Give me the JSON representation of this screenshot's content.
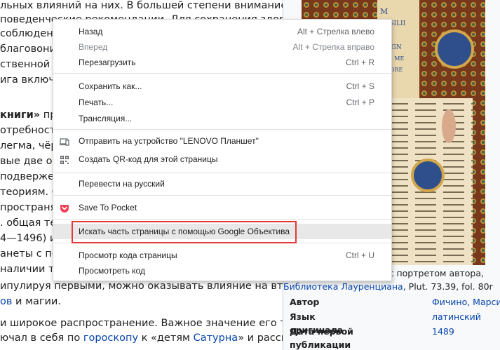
{
  "article": {
    "lines": [
      {
        "segs": [
          {
            "t": "льных влияний на них. В большей степени внимание"
          }
        ]
      },
      {
        "segs": [
          {
            "t": " поведенческие рекомендации. Для сохранения здоровья"
          }
        ]
      },
      {
        "segs": [
          {
            "t": "соблюдени"
          }
        ]
      },
      {
        "segs": [
          {
            "t": "благовония"
          }
        ]
      },
      {
        "segs": [
          {
            "t": "ственной бл"
          }
        ]
      },
      {
        "segs": [
          {
            "t": "ига включа"
          }
        ]
      },
      {
        "segs": [
          {
            "t": ""
          }
        ]
      },
      {
        "segs": [
          {
            "t": " книги»",
            "b": true
          },
          {
            "t": " про"
          }
        ]
      },
      {
        "segs": [
          {
            "t": "отребностям"
          }
        ]
      },
      {
        "segs": [
          {
            "t": "легма, чёрн"
          }
        ]
      },
      {
        "segs": [
          {
            "t": "вые две оп"
          }
        ]
      },
      {
        "segs": [
          {
            "t": "подвержен"
          }
        ]
      },
      {
        "segs": [
          {
            "t": "теориям. С"
          }
        ]
      },
      {
        "segs": [
          {
            "t": "пространяе"
          }
        ]
      },
      {
        "segs": [
          {
            "t": ". общая тео"
          }
        ]
      },
      {
        "segs": [
          {
            "t": "4—1496) и"
          }
        ]
      },
      {
        "segs": [
          {
            "t": "анеты с пом"
          }
        ]
      },
      {
        "segs": [
          {
            "t": "наличии та"
          }
        ]
      },
      {
        "segs": [
          {
            "t": "ипулируя первыми, можно оказывать влияние на вторые."
          }
        ]
      },
      {
        "segs": [
          {
            "t": "ов",
            "link": true
          },
          {
            "t": " и магии."
          }
        ]
      },
      {
        "segs": [
          {
            "t": ""
          }
        ]
      },
      {
        "segs": [
          {
            "t": "и широкое распространение. Важное значение его трактат"
          }
        ]
      },
      {
        "segs": [
          {
            "t": "ючал в себя по "
          },
          {
            "t": "гороскопу",
            "link": true
          },
          {
            "t": " к «детям "
          },
          {
            "t": "Сатурна",
            "link": true
          },
          {
            "t": "» и рассматривая"
          }
        ]
      }
    ]
  },
  "infobox": {
    "caption_line1": "с портретом автора,",
    "caption_link": "Библиотека Лауренциана",
    "caption_rest": ", Plut. 73.39, fol. 80r",
    "manuscript_text": [
      "M",
      "ERSILII",
      "LI",
      "MAGN",
      "TIVS ME",
      "VATORE"
    ],
    "rows": [
      {
        "key": "Автор",
        "value": "Фичино, Марсилио"
      },
      {
        "key": "Язык оригинала",
        "value": "латинский"
      },
      {
        "key": "Дата первой публикации",
        "value": "1489"
      }
    ]
  },
  "context_menu": {
    "groups": [
      [
        {
          "label": "Назад",
          "shortcut": "Alt + Стрелка влево",
          "disabled": false,
          "icon": ""
        },
        {
          "label": "Вперед",
          "shortcut": "Alt + Стрелка вправо",
          "disabled": true,
          "icon": ""
        },
        {
          "label": "Перезагрузить",
          "shortcut": "Ctrl + R",
          "disabled": false,
          "icon": ""
        }
      ],
      [
        {
          "label": "Сохранить как...",
          "shortcut": "Ctrl + S",
          "disabled": false,
          "icon": ""
        },
        {
          "label": "Печать...",
          "shortcut": "Ctrl + P",
          "disabled": false,
          "icon": ""
        },
        {
          "label": "Трансляция...",
          "shortcut": "",
          "disabled": false,
          "icon": ""
        }
      ],
      [
        {
          "label": "Отправить на устройство \"LENOVO Планшет\"",
          "shortcut": "",
          "disabled": false,
          "icon": "device-icon"
        },
        {
          "label": "Создать QR-код для этой страницы",
          "shortcut": "",
          "disabled": false,
          "icon": "qr-code-icon"
        }
      ],
      [
        {
          "label": "Перевести на русский",
          "shortcut": "",
          "disabled": false,
          "icon": ""
        }
      ],
      [
        {
          "label": "Save To Pocket",
          "shortcut": "",
          "disabled": false,
          "icon": "pocket-icon"
        }
      ],
      [
        {
          "label": "Искать часть страницы с помощью Google Объектива",
          "shortcut": "",
          "disabled": false,
          "icon": "",
          "hovered": true
        }
      ],
      [
        {
          "label": "Просмотр кода страницы",
          "shortcut": "Ctrl + U",
          "disabled": false,
          "icon": ""
        },
        {
          "label": "Просмотреть код",
          "shortcut": "",
          "disabled": false,
          "icon": ""
        }
      ]
    ],
    "colors": {
      "highlight_border": "#e53935",
      "hover_bg": "#e8e8e8",
      "pocket": "#ef4056"
    }
  }
}
